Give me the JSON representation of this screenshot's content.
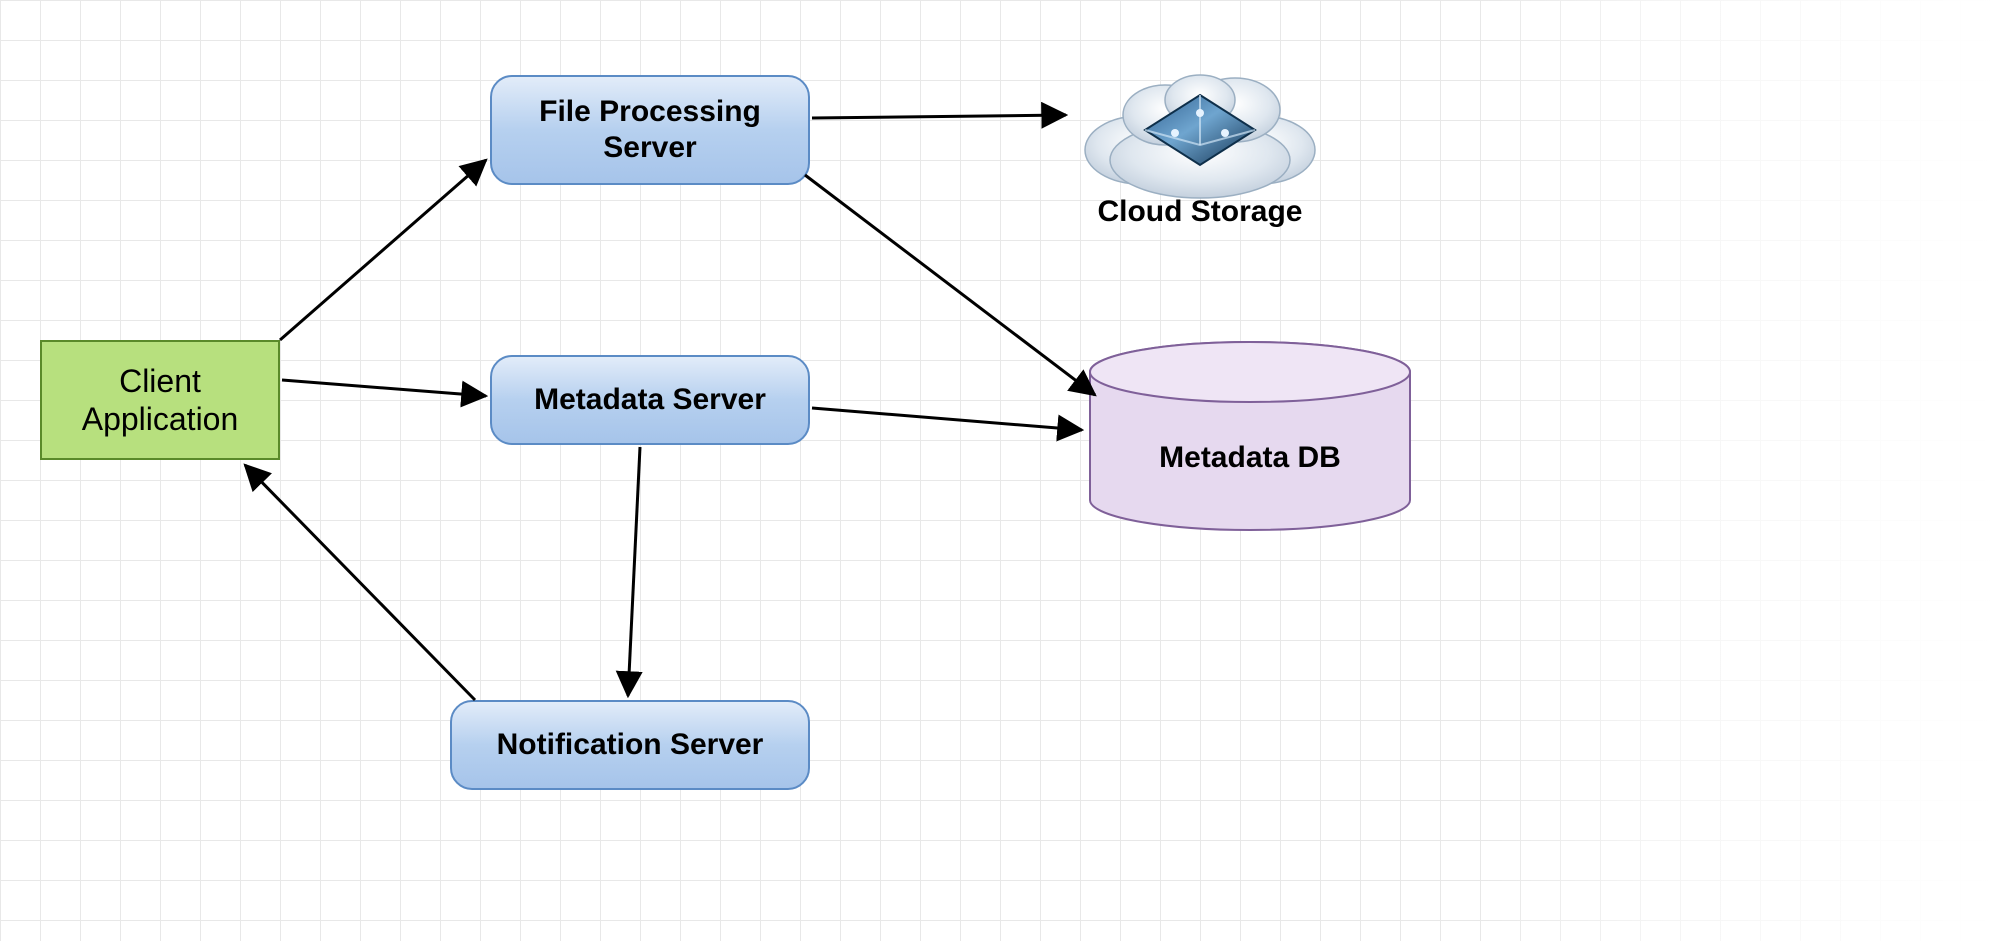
{
  "nodes": {
    "client": {
      "label_line1": "Client",
      "label_line2": "Application"
    },
    "file_processing": {
      "label_line1": "File Processing",
      "label_line2": "Server"
    },
    "metadata_server": {
      "label": "Metadata Server"
    },
    "notification_server": {
      "label": "Notification Server"
    },
    "cloud_storage": {
      "label": "Cloud Storage"
    },
    "metadata_db": {
      "label": "Metadata DB"
    }
  },
  "edges": [
    {
      "from": "client",
      "to": "file_processing"
    },
    {
      "from": "client",
      "to": "metadata_server"
    },
    {
      "from": "file_processing",
      "to": "cloud_storage"
    },
    {
      "from": "file_processing",
      "to": "metadata_db"
    },
    {
      "from": "metadata_server",
      "to": "metadata_db"
    },
    {
      "from": "metadata_server",
      "to": "notification_server"
    },
    {
      "from": "notification_server",
      "to": "client"
    }
  ],
  "colors": {
    "client_fill": "#b7e07e",
    "client_stroke": "#5a8a2a",
    "server_fill_top": "#e2ecf9",
    "server_fill_bottom": "#a6c4ea",
    "server_stroke": "#5b8bc5",
    "db_fill": "#e6d9ef",
    "db_stroke": "#8a6fa8",
    "arrow": "#000000"
  }
}
